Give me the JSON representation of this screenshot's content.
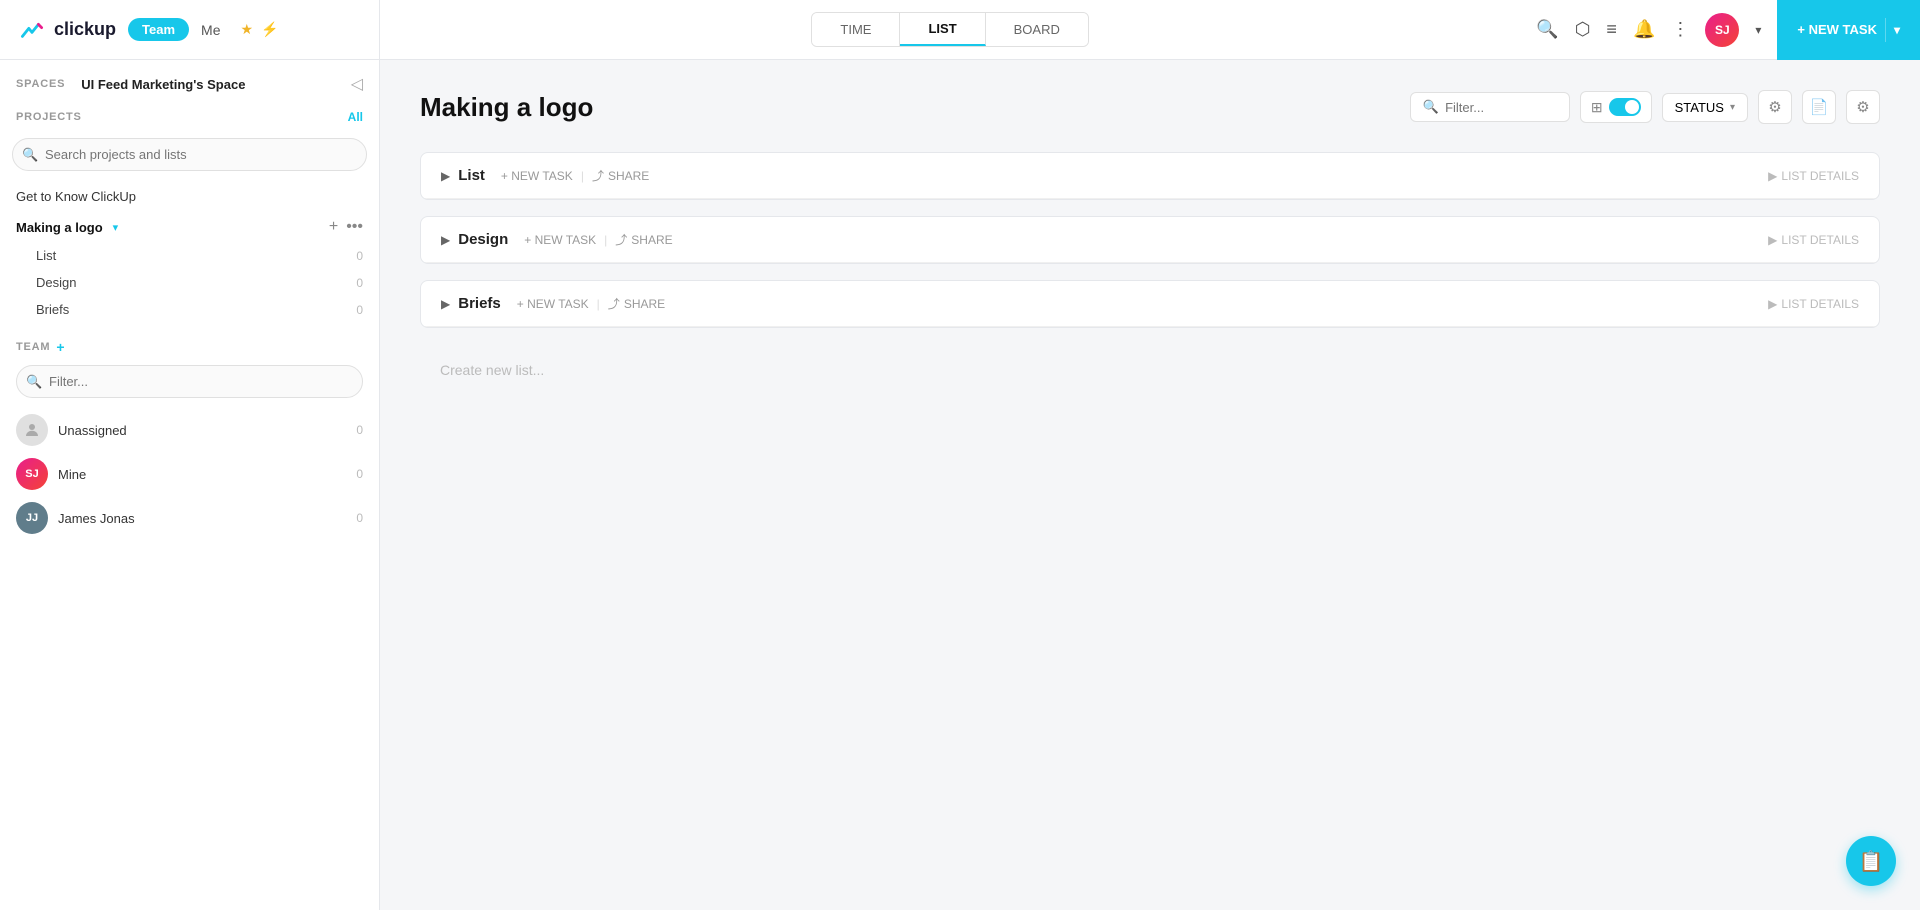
{
  "app": {
    "name": "clickup",
    "logo_text": "clickup"
  },
  "nav": {
    "team_badge": "Team",
    "me_label": "Me",
    "tabs": [
      {
        "id": "time",
        "label": "TIME",
        "active": false
      },
      {
        "id": "list",
        "label": "LIST",
        "active": true
      },
      {
        "id": "board",
        "label": "BOARD",
        "active": false
      }
    ],
    "new_task_btn": "+ NEW TASK",
    "user_initials": "SJ"
  },
  "sidebar": {
    "spaces_label": "SPACES",
    "space_name": "UI Feed Marketing's Space",
    "projects_label": "PROJECTS",
    "projects_all": "All",
    "search_placeholder": "Search projects and lists",
    "project_items": [
      {
        "name": "Get to Know ClickUp",
        "bold": false
      }
    ],
    "active_folder": {
      "name": "Making a logo",
      "lists": [
        {
          "name": "List",
          "count": "0"
        },
        {
          "name": "Design",
          "count": "0"
        },
        {
          "name": "Briefs",
          "count": "0"
        }
      ]
    },
    "team_label": "TEAM",
    "team_filter_placeholder": "Filter...",
    "team_members": [
      {
        "name": "Unassigned",
        "initials": "?",
        "type": "unassigned",
        "count": "0"
      },
      {
        "name": "Mine",
        "initials": "SJ",
        "type": "sj",
        "count": "0"
      },
      {
        "name": "James Jonas",
        "initials": "JJ",
        "type": "jj",
        "count": "0"
      }
    ]
  },
  "main": {
    "page_title": "Making a logo",
    "filter_placeholder": "Filter...",
    "status_label": "STATUS",
    "lists": [
      {
        "name": "List",
        "new_task": "+ NEW TASK",
        "share": "SHARE",
        "details": "LIST DETAILS"
      },
      {
        "name": "Design",
        "new_task": "+ NEW TASK",
        "share": "SHARE",
        "details": "LIST DETAILS"
      },
      {
        "name": "Briefs",
        "new_task": "+ NEW TASK",
        "share": "SHARE",
        "details": "LIST DETAILS"
      }
    ],
    "create_new_list": "Create new list..."
  }
}
